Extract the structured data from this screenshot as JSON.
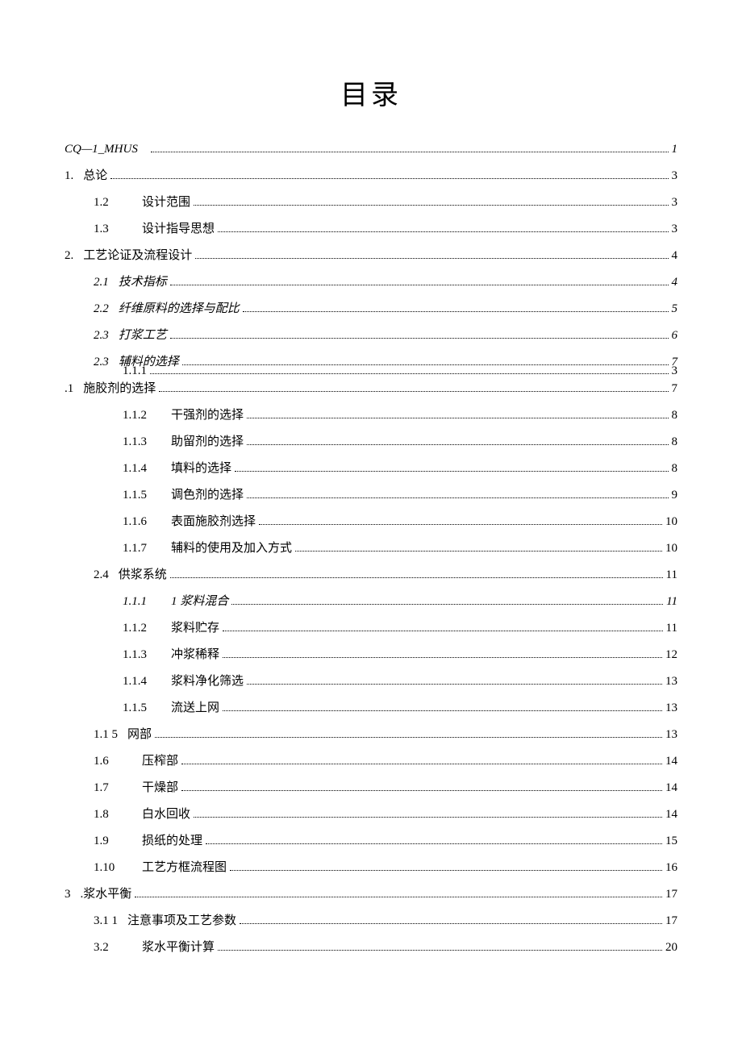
{
  "title": "目录",
  "entries": [
    {
      "indent": 0,
      "italic": true,
      "num": "CQ—1_MHUS",
      "text": "",
      "page": "1",
      "numClass": ""
    },
    {
      "indent": 0,
      "italic": false,
      "num": "1.",
      "text": "总论",
      "page": "3",
      "numClass": ""
    },
    {
      "indent": 1,
      "italic": false,
      "num": "1.2",
      "text": "设计范围",
      "page": "3",
      "numClass": "num-wide"
    },
    {
      "indent": 1,
      "italic": false,
      "num": "1.3",
      "text": "设计指导思想",
      "page": "3",
      "numClass": "num-wide"
    },
    {
      "indent": 0,
      "italic": false,
      "num": "2.",
      "text": "工艺论证及流程设计",
      "page": "4",
      "numClass": ""
    },
    {
      "indent": 1,
      "italic": true,
      "num": "2.1",
      "text": "技术指标",
      "page": "4",
      "numClass": ""
    },
    {
      "indent": 1,
      "italic": true,
      "num": "2.2",
      "text": "纤维原料的选择与配比",
      "page": "5",
      "numClass": ""
    },
    {
      "indent": 1,
      "italic": true,
      "num": "2.3",
      "text": "打浆工艺",
      "page": "6",
      "numClass": ""
    },
    {
      "indent": 1,
      "italic": true,
      "num": "2.3",
      "text": "辅料的选择",
      "page": "7",
      "numClass": ""
    }
  ],
  "overlay": {
    "num": "1.1.1",
    "page": "3"
  },
  "entry_main": {
    "indent": 0,
    "italic": false,
    "num": ".1",
    "text": "施胶剂的选择",
    "page": "7"
  },
  "entries2": [
    {
      "indent": 2,
      "italic": false,
      "num": "1.1.2",
      "text": "干强剂的选择",
      "page": "8",
      "numClass": "num-wide"
    },
    {
      "indent": 2,
      "italic": false,
      "num": "1.1.3",
      "text": "助留剂的选择",
      "page": "8",
      "numClass": "num-wide"
    },
    {
      "indent": 2,
      "italic": false,
      "num": "1.1.4",
      "text": "填料的选择",
      "page": "8",
      "numClass": "num-wide"
    },
    {
      "indent": 2,
      "italic": false,
      "num": "1.1.5",
      "text": "调色剂的选择",
      "page": "9",
      "numClass": "num-wide"
    },
    {
      "indent": 2,
      "italic": false,
      "num": "1.1.6",
      "text": "表面施胶剂选择",
      "page": "10",
      "numClass": "num-wide"
    },
    {
      "indent": 2,
      "italic": false,
      "num": "1.1.7",
      "text": "辅料的使用及加入方式",
      "page": "10",
      "numClass": "num-wide"
    },
    {
      "indent": 1,
      "italic": false,
      "num": "2.4",
      "text": "供浆系统",
      "page": "11",
      "numClass": ""
    },
    {
      "indent": 2,
      "italic": true,
      "num": "1.1.1",
      "text": "1 浆料混合",
      "page": "11",
      "numClass": "num-wide"
    },
    {
      "indent": 2,
      "italic": false,
      "num": "1.1.2",
      "text": "浆料贮存",
      "page": "11",
      "numClass": "num-wide"
    },
    {
      "indent": 2,
      "italic": false,
      "num": "1.1.3",
      "text": "冲浆稀释",
      "page": "12",
      "numClass": "num-wide"
    },
    {
      "indent": 2,
      "italic": false,
      "num": "1.1.4",
      "text": "浆料净化筛选",
      "page": "13",
      "numClass": "num-wide"
    },
    {
      "indent": 2,
      "italic": false,
      "num": "1.1.5",
      "text": "流送上网",
      "page": "13",
      "numClass": "num-wide"
    },
    {
      "indent": 1,
      "italic": false,
      "num": "1.1 5",
      "text": "网部",
      "page": "13",
      "numClass": ""
    },
    {
      "indent": 1,
      "italic": false,
      "num": "1.6",
      "text": "压榨部",
      "page": "14",
      "numClass": "num-wide"
    },
    {
      "indent": 1,
      "italic": false,
      "num": "1.7",
      "text": "干燥部",
      "page": "14",
      "numClass": "num-wide"
    },
    {
      "indent": 1,
      "italic": false,
      "num": "1.8",
      "text": "白水回收",
      "page": "14",
      "numClass": "num-wide"
    },
    {
      "indent": 1,
      "italic": false,
      "num": "1.9",
      "text": "损纸的处理",
      "page": "15",
      "numClass": "num-wide"
    },
    {
      "indent": 1,
      "italic": false,
      "num": "1.10",
      "text": "工艺方框流程图",
      "page": "16",
      "numClass": "num-wide"
    },
    {
      "indent": 0,
      "italic": false,
      "num": "3",
      "text": ".浆水平衡",
      "page": "17",
      "numClass": ""
    },
    {
      "indent": 1,
      "italic": false,
      "num": "3.1 1",
      "text": "注意事项及工艺参数",
      "page": "17",
      "numClass": ""
    },
    {
      "indent": 1,
      "italic": false,
      "num": "3.2",
      "text": "浆水平衡计算",
      "page": "20",
      "numClass": "num-wide"
    }
  ]
}
